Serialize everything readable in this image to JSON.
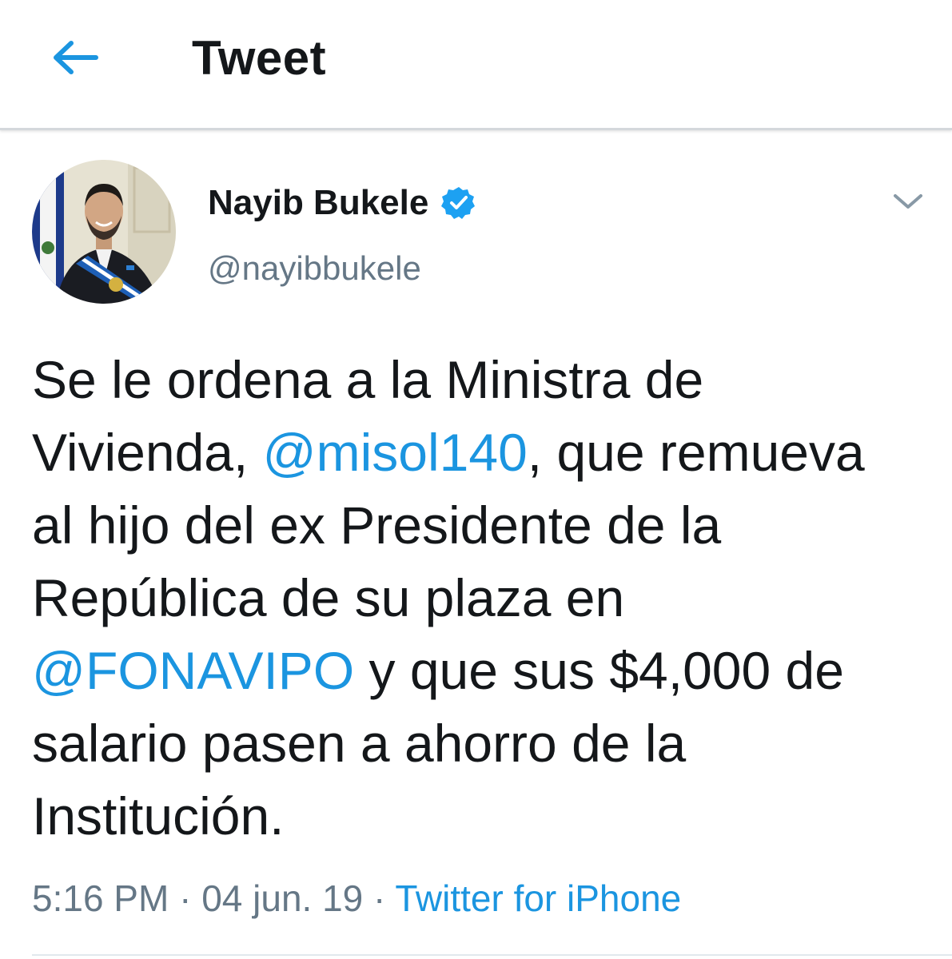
{
  "header": {
    "title": "Tweet",
    "back_icon": "arrow-left-icon"
  },
  "tweet": {
    "author": {
      "name": "Nayib Bukele",
      "handle": "@nayibbukele",
      "verified_icon": "verified-badge-icon"
    },
    "menu_icon": "chevron-down-icon",
    "body": {
      "t1": "Se le ordena a la Ministra de Vivienda, ",
      "mention1": "@misol140",
      "t2": ", que remueva al hijo del ex Presidente de la República de su plaza en ",
      "mention2": "@FONAVIPO",
      "t3": " y que sus $4,000 de salario pasen a ahorro de la Institución."
    },
    "meta": {
      "time": "5:16 PM",
      "sep": " · ",
      "date": "04 jun. 19",
      "source": "Twitter for iPhone"
    }
  },
  "colors": {
    "accent": "#1b95e0",
    "text": "#14171a",
    "muted": "#657786",
    "divider": "#e1e8ed"
  }
}
